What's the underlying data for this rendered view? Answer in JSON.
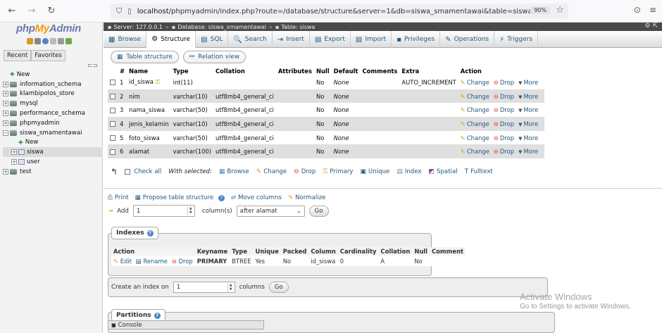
{
  "browser": {
    "url_host": "localhost",
    "url_path": "/phpmyadmin/index.php?route=/database/structure&server=1&db=siswa_smamentawai&table=siswa",
    "zoom": "90%"
  },
  "sidebar": {
    "logo": {
      "php": "php",
      "my": "My",
      "admin": "Admin"
    },
    "recent_tab": "Recent",
    "favorites_tab": "Favorites",
    "tree": [
      {
        "label": "New",
        "kind": "new",
        "indent": 0
      },
      {
        "label": "information_schema",
        "kind": "db",
        "indent": 0
      },
      {
        "label": "klambipolos_store",
        "kind": "db",
        "indent": 0
      },
      {
        "label": "mysql",
        "kind": "db",
        "indent": 0
      },
      {
        "label": "performance_schema",
        "kind": "db",
        "indent": 0
      },
      {
        "label": "phpmyadmin",
        "kind": "db",
        "indent": 0
      },
      {
        "label": "siswa_smamentawai",
        "kind": "db-open",
        "indent": 0
      },
      {
        "label": "New",
        "kind": "new",
        "indent": 1
      },
      {
        "label": "siswa",
        "kind": "table",
        "indent": 1,
        "selected": true
      },
      {
        "label": "user",
        "kind": "table",
        "indent": 1
      },
      {
        "label": "test",
        "kind": "db",
        "indent": 0
      }
    ]
  },
  "breadcrumb": {
    "server": "Server: 127.0.0.1",
    "database": "Database: siswa_smamentawai",
    "table": "Table: siswa"
  },
  "topmenu": [
    {
      "label": "Browse",
      "icon": "browse-icon",
      "glyph": "▦"
    },
    {
      "label": "Structure",
      "icon": "structure-icon",
      "glyph": "⚙",
      "active": true
    },
    {
      "label": "SQL",
      "icon": "sql-icon",
      "glyph": "▤"
    },
    {
      "label": "Search",
      "icon": "search-icon",
      "glyph": "🔍"
    },
    {
      "label": "Insert",
      "icon": "insert-icon",
      "glyph": "⇥"
    },
    {
      "label": "Export",
      "icon": "export-icon",
      "glyph": "▤"
    },
    {
      "label": "Import",
      "icon": "import-icon",
      "glyph": "▤"
    },
    {
      "label": "Privileges",
      "icon": "privileges-icon",
      "glyph": "▪"
    },
    {
      "label": "Operations",
      "icon": "operations-icon",
      "glyph": "✎"
    },
    {
      "label": "Triggers",
      "icon": "triggers-icon",
      "glyph": "⚡"
    }
  ],
  "subtabs": {
    "table_structure": "Table structure",
    "relation_view": "Relation view"
  },
  "structure": {
    "headers": [
      "#",
      "Name",
      "Type",
      "Collation",
      "Attributes",
      "Null",
      "Default",
      "Comments",
      "Extra",
      "Action"
    ],
    "rows": [
      {
        "num": "1",
        "name": "id_siswa",
        "key": true,
        "type": "int(11)",
        "collation": "",
        "attributes": "",
        "null": "No",
        "default": "None",
        "comments": "",
        "extra": "AUTO_INCREMENT"
      },
      {
        "num": "2",
        "name": "nim",
        "type": "varchar(10)",
        "collation": "utf8mb4_general_ci",
        "attributes": "",
        "null": "No",
        "default": "None",
        "comments": "",
        "extra": ""
      },
      {
        "num": "3",
        "name": "nama_siswa",
        "type": "varchar(50)",
        "collation": "utf8mb4_general_ci",
        "attributes": "",
        "null": "No",
        "default": "None",
        "comments": "",
        "extra": ""
      },
      {
        "num": "4",
        "name": "jenis_kelamin",
        "type": "varchar(10)",
        "collation": "utf8mb4_general_ci",
        "attributes": "",
        "null": "No",
        "default": "None",
        "comments": "",
        "extra": ""
      },
      {
        "num": "5",
        "name": "foto_siswa",
        "type": "varchar(50)",
        "collation": "utf8mb4_general_ci",
        "attributes": "",
        "null": "No",
        "default": "None",
        "comments": "",
        "extra": ""
      },
      {
        "num": "6",
        "name": "alamat",
        "type": "varchar(100)",
        "collation": "utf8mb4_general_ci",
        "attributes": "",
        "null": "No",
        "default": "None",
        "comments": "",
        "extra": ""
      }
    ],
    "actions": {
      "change": "Change",
      "drop": "Drop",
      "more": "More"
    }
  },
  "bulk": {
    "check_all": "Check all",
    "with_selected": "With selected:",
    "browse": "Browse",
    "change": "Change",
    "drop": "Drop",
    "primary": "Primary",
    "unique": "Unique",
    "index": "Index",
    "spatial": "Spatial",
    "fulltext": "Fulltext"
  },
  "tools": {
    "print": "Print",
    "propose": "Propose table structure",
    "move_columns": "Move columns",
    "normalize": "Normalize"
  },
  "add_columns": {
    "label": "Add",
    "count": "1",
    "suffix": "column(s)",
    "position": "after alamat",
    "go": "Go"
  },
  "indexes": {
    "legend": "Indexes",
    "headers": [
      "Action",
      "Keyname",
      "Type",
      "Unique",
      "Packed",
      "Column",
      "Cardinality",
      "Collation",
      "Null",
      "Comment"
    ],
    "rows": [
      {
        "edit": "Edit",
        "rename": "Rename",
        "drop": "Drop",
        "keyname": "PRIMARY",
        "type": "BTREE",
        "unique": "Yes",
        "packed": "No",
        "column": "id_siswa",
        "cardinality": "0",
        "collation": "A",
        "null": "No",
        "comment": ""
      }
    ],
    "create_label": "Create an index on",
    "create_count": "1",
    "create_suffix": "columns",
    "go": "Go"
  },
  "partitions": {
    "legend": "Partitions"
  },
  "console": {
    "label": "Console"
  },
  "watermark": {
    "title": "Activate Windows",
    "subtitle": "Go to Settings to activate Windows."
  }
}
